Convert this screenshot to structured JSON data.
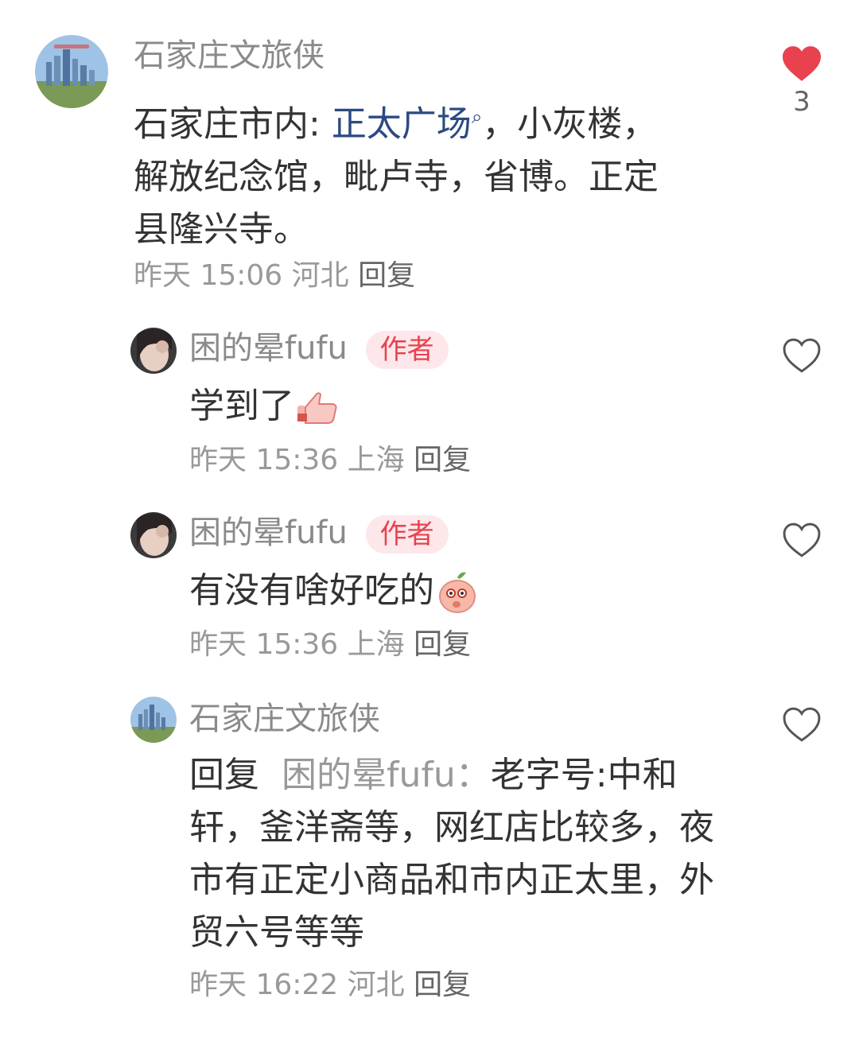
{
  "colors": {
    "like_active": "#e8424f",
    "badge_bg": "#fde7ea",
    "badge_text": "#e8424f",
    "link": "#2b4a82"
  },
  "comments": [
    {
      "user": "石家庄文旅侠",
      "text_prefix": "石家庄市内: ",
      "link": "正太广场",
      "text_suffix": "，小灰楼，解放纪念馆，毗卢寺，省博。正定县隆兴寺。",
      "time": "昨天 15:06",
      "location": "河北",
      "reply": "回复",
      "likes": "3",
      "liked": true
    }
  ],
  "replies": [
    {
      "user": "困的晕fufu",
      "badge": "作者",
      "text": "学到了",
      "emoji": "thumbs-up-emoji",
      "time": "昨天 15:36",
      "location": "上海",
      "reply": "回复"
    },
    {
      "user": "困的晕fufu",
      "badge": "作者",
      "text": "有没有啥好吃的",
      "emoji": "peach-face-emoji",
      "time": "昨天 15:36",
      "location": "上海",
      "reply": "回复"
    },
    {
      "user": "石家庄文旅侠",
      "reply_label": "回复",
      "reply_to": "困的晕fufu：",
      "text": "老字号:中和轩，釜洋斋等，网红店比较多，夜市有正定小商品和市内正太里，外贸六号等等",
      "time": "昨天 16:22",
      "location": "河北",
      "reply": "回复"
    }
  ]
}
